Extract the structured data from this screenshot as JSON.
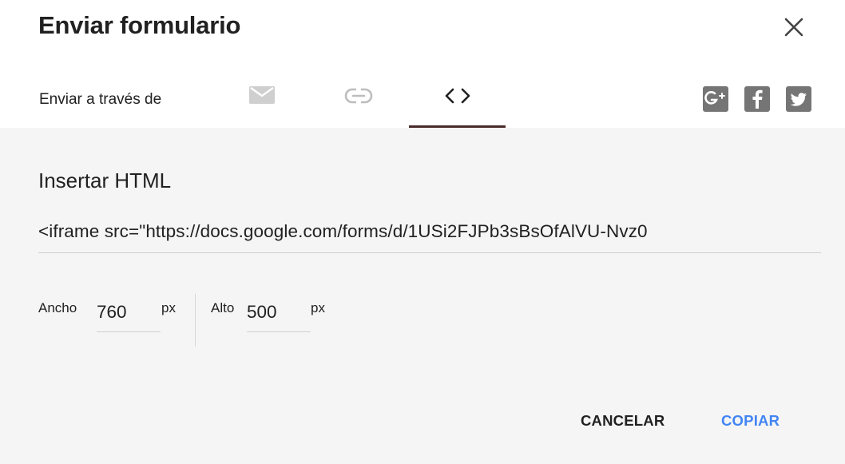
{
  "dialog": {
    "title": "Enviar formulario",
    "close_icon": "close-icon"
  },
  "send": {
    "label": "Enviar a través de",
    "tabs": [
      {
        "id": "email",
        "icon": "email-icon",
        "selected": false
      },
      {
        "id": "link",
        "icon": "link-icon",
        "selected": false
      },
      {
        "id": "embed",
        "icon": "code-icon",
        "selected": true
      }
    ],
    "social": [
      {
        "id": "gplus",
        "icon": "google-plus-icon"
      },
      {
        "id": "facebook",
        "icon": "facebook-icon"
      },
      {
        "id": "twitter",
        "icon": "twitter-icon"
      }
    ]
  },
  "embed": {
    "title": "Insertar HTML",
    "code": "<iframe src=\"https://docs.google.com/forms/d/1USi2FJPb3sBsOfAlVU-Nvz0",
    "width_label": "Ancho",
    "width_value": "760",
    "width_unit": "px",
    "height_label": "Alto",
    "height_value": "500",
    "height_unit": "px"
  },
  "actions": {
    "cancel": "CANCELAR",
    "copy": "COPIAR"
  },
  "colors": {
    "accent": "#4285f4",
    "tab_indicator": "#4a2b2b",
    "icon_grey": "#757575",
    "panel_bg": "#f5f5f5"
  }
}
